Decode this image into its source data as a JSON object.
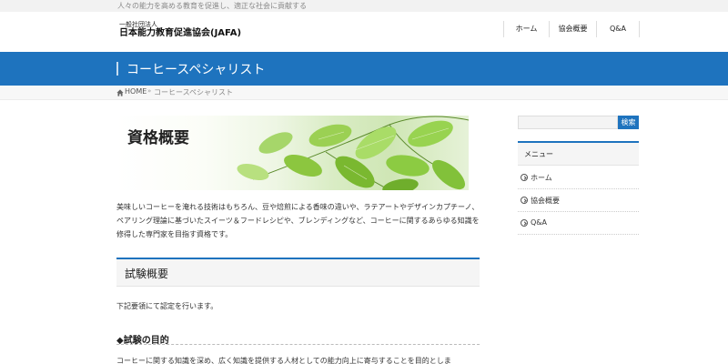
{
  "site": {
    "tagline": "人々の能力を高める教育を促進し、適正な社会に貢献する",
    "logo_sub": "一般社団法人",
    "logo_main": "日本能力教育促進協会(JAFA)"
  },
  "nav": {
    "items": [
      {
        "label": "ホーム"
      },
      {
        "label": "協会概要"
      },
      {
        "label": "Q&A"
      }
    ]
  },
  "page": {
    "title": "コーヒースペシャリスト"
  },
  "breadcrumb": {
    "home": "HOME",
    "separator": "»",
    "current": "コーヒースペシャリスト"
  },
  "content": {
    "hero_title": "資格概要",
    "intro": "美味しいコーヒーを淹れる技術はもちろん、豆や焙煎による香味の違いや、ラテアートやデザインカプチーノ、ペアリング理論に基づいたスイーツ＆フードレシピや、ブレンディングなど、コーヒーに関するあらゆる知識を修得した専門家を目指す資格です。",
    "section_heading": "試験概要",
    "section_text": "下記要領にて認定を行います。",
    "subheading": "◆試験の目的",
    "sub_text": "コーヒーに関する知識を深め、広く知識を提供する人材としての能力向上に寄与することを目的としま"
  },
  "sidebar": {
    "search_placeholder": "",
    "search_button": "検索",
    "menu_title": "メニュー",
    "menu_items": [
      {
        "label": "ホーム"
      },
      {
        "label": "協会概要"
      },
      {
        "label": "Q&A"
      }
    ]
  },
  "colors": {
    "accent": "#1e73be",
    "leaf": "#8cc63f"
  }
}
